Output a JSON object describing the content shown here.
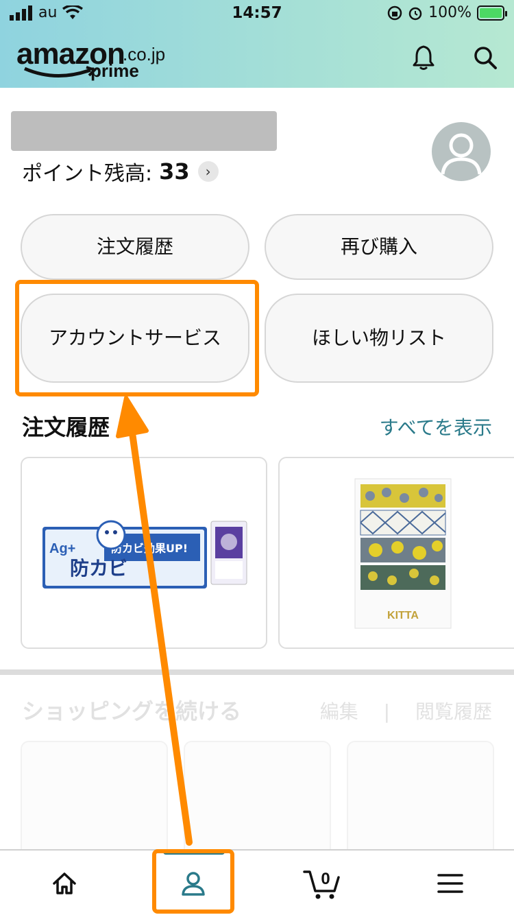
{
  "status_bar": {
    "carrier": "au",
    "time": "14:57",
    "battery": "100%"
  },
  "header": {
    "logo_main": "amazon",
    "logo_domain": ".co.jp",
    "logo_sub": "prime",
    "icons": [
      "bell-icon",
      "search-icon"
    ]
  },
  "account": {
    "points_label": "ポイント残高:",
    "points_value": "33"
  },
  "quick_actions": {
    "orders": "注文履歴",
    "buy_again": "再び購入",
    "account_services": "アカウントサービス",
    "wishlist": "ほしい物リスト"
  },
  "orders_section": {
    "title": "注文履歴",
    "view_all": "すべてを表示"
  },
  "products": {
    "card1": {
      "brand_lines": [
        "Ag+",
        "防カビ",
        "防カビ効果UP!"
      ]
    },
    "card2": {
      "label": "KITTA"
    }
  },
  "continue_shopping": {
    "title": "ショッピングを続ける",
    "edit": "編集",
    "separator": "|",
    "history": "閲覧履歴"
  },
  "bottom_nav": {
    "items": [
      "home-icon",
      "account-icon",
      "cart-icon",
      "menu-icon"
    ],
    "cart_count": "0"
  },
  "colors": {
    "highlight": "#ff8a00",
    "link": "#2a7a8a",
    "header_gradient_start": "#8fd3df",
    "header_gradient_end": "#b6e8d2"
  }
}
